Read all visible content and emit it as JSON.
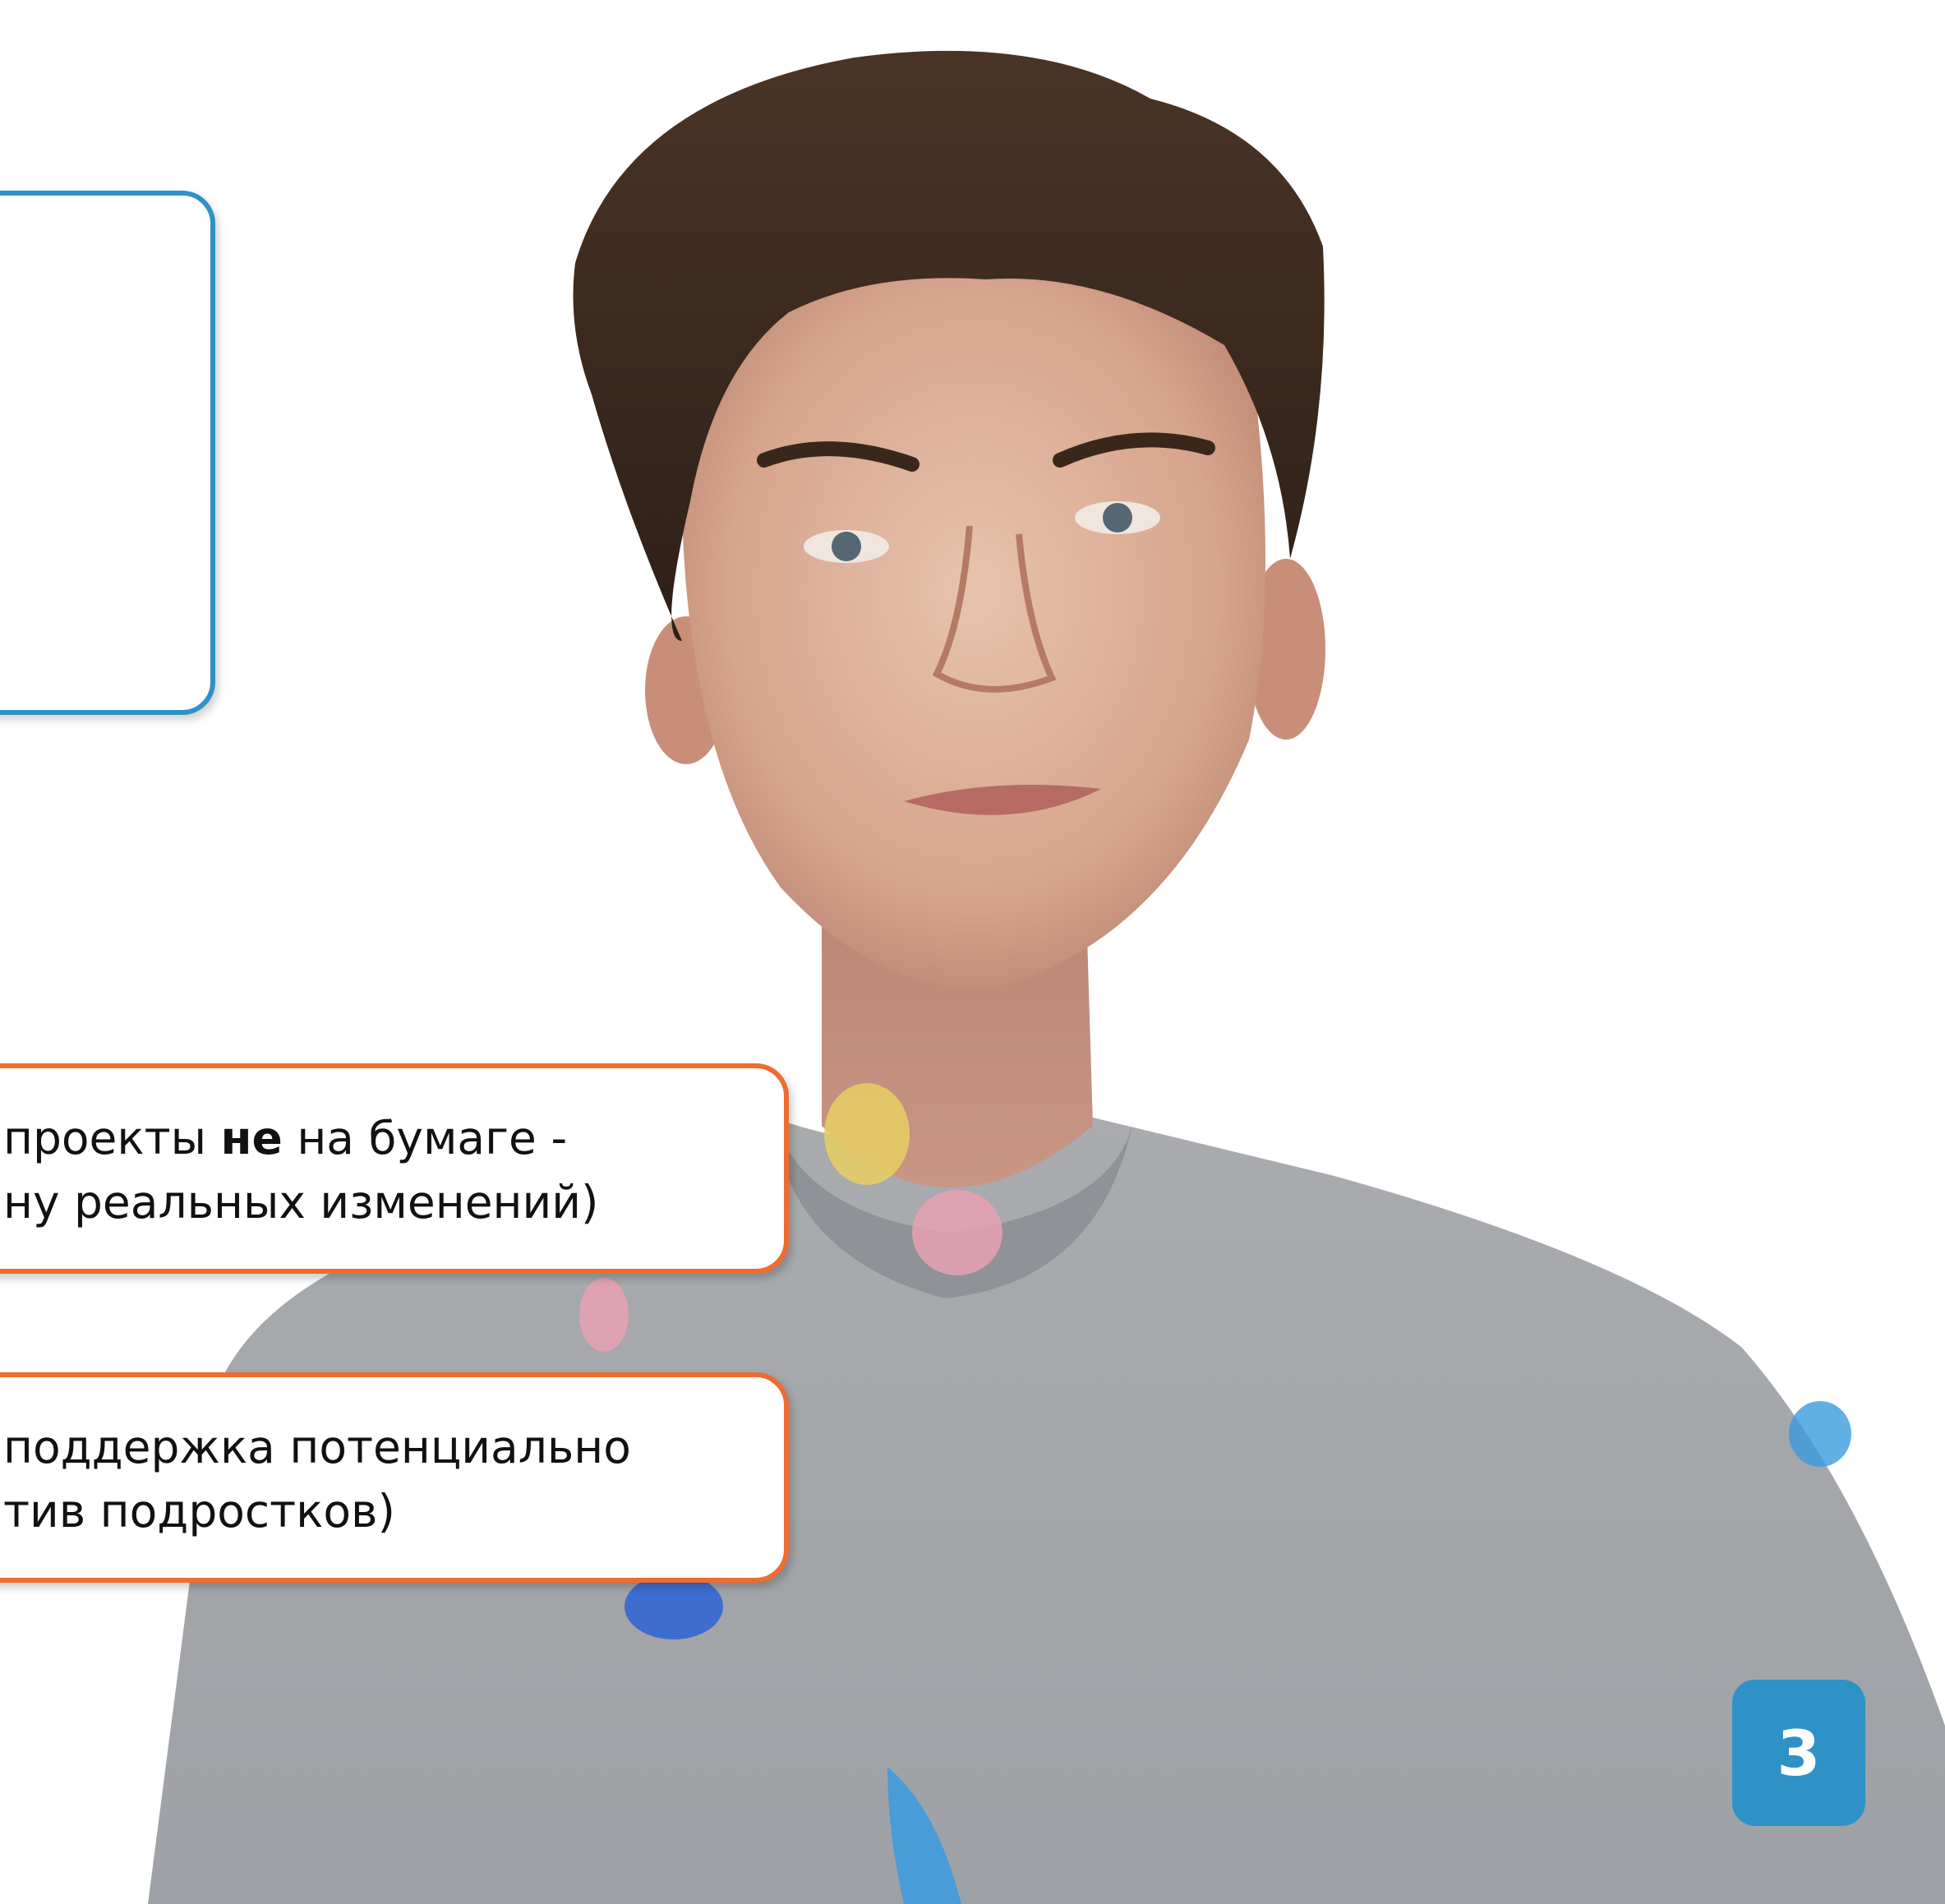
{
  "callouts": [
    {
      "line1_pre": "проекты ",
      "line1_bold": "не",
      "line1_post": " на бумаге -",
      "line2": "ну реальных изменений)"
    },
    {
      "line1": "поддержка потенциально",
      "line2": "тив подростков)"
    }
  ],
  "page_number": "3",
  "colors": {
    "accent_blue": "#2f92c6",
    "accent_orange": "#ef6c2f"
  },
  "icons": {
    "photo": "young-man-portrait-grey-sweatshirt"
  }
}
